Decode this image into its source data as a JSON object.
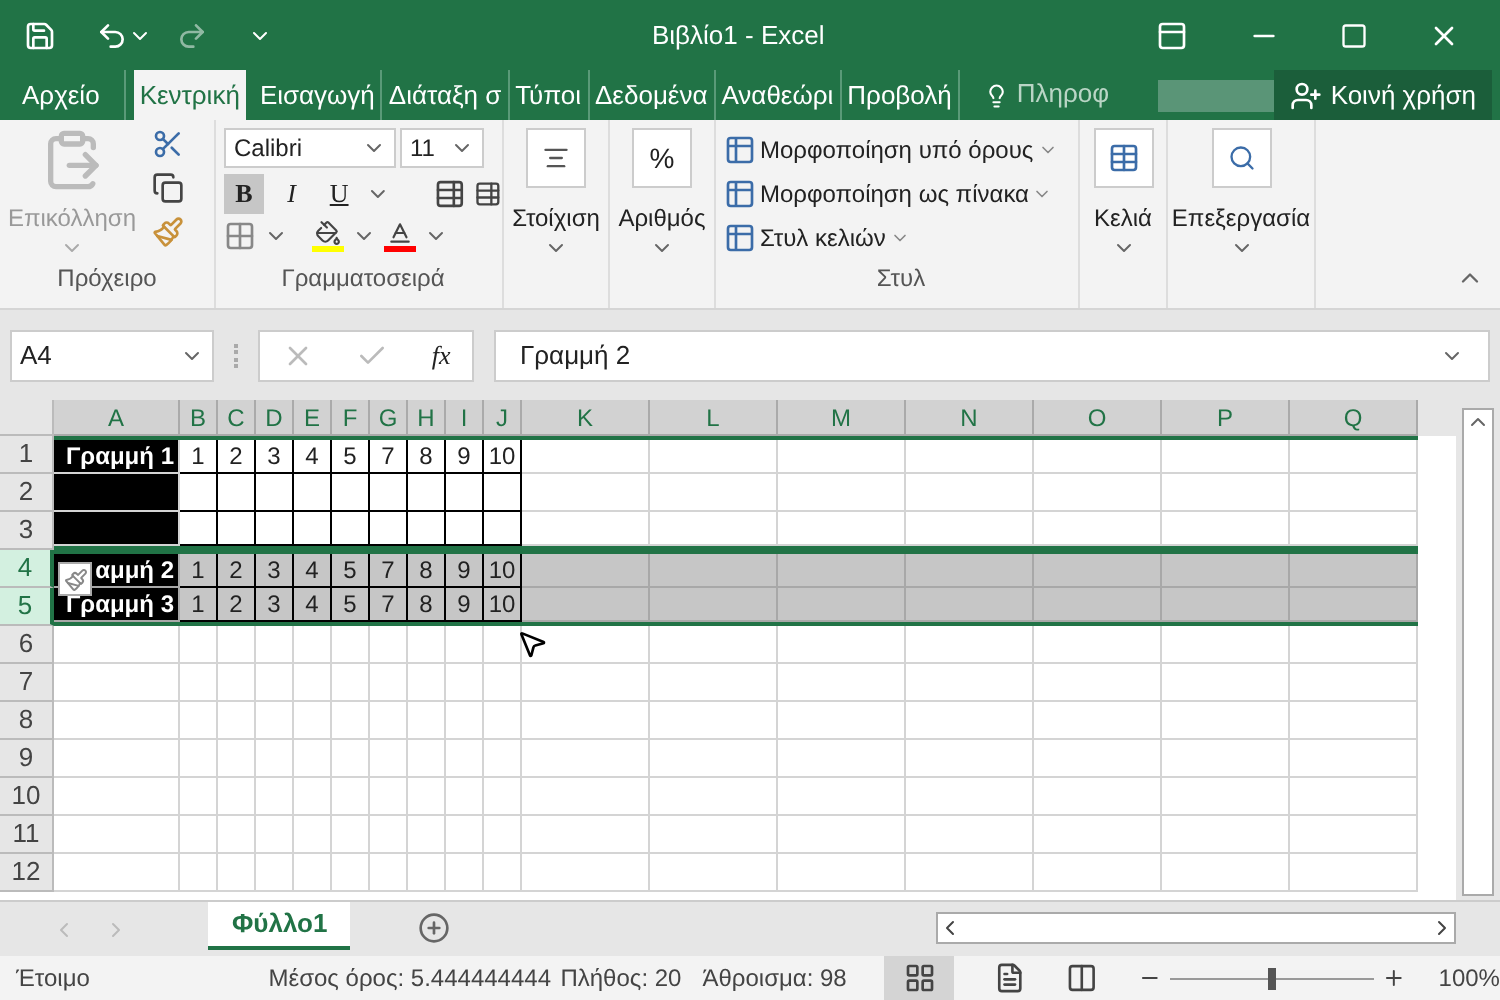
{
  "window": {
    "title": "Βιβλίο1 - Excel"
  },
  "ribbon_tabs": [
    {
      "label": "Αρχείο",
      "selected": false
    },
    {
      "label": "Κεντρική",
      "selected": true
    },
    {
      "label": "Εισαγωγή",
      "selected": false
    },
    {
      "label": "Διάταξη σ",
      "selected": false
    },
    {
      "label": "Τύποι",
      "selected": false
    },
    {
      "label": "Δεδομένα",
      "selected": false
    },
    {
      "label": "Αναθεώρι",
      "selected": false
    },
    {
      "label": "Προβολή",
      "selected": false
    }
  ],
  "tell_me": "Πληροφ",
  "share_button": "Κοινή χρήση",
  "clipboard": {
    "paste": "Επικόλληση",
    "label": "Πρόχειρο"
  },
  "font": {
    "name": "Calibri",
    "size": "11",
    "label": "Γραμματοσειρά",
    "style_buttons": [
      {
        "label": "B",
        "selected": true
      },
      {
        "label": "I",
        "selected": false
      },
      {
        "label": "U",
        "selected": false
      }
    ]
  },
  "alignment": {
    "label": "Στοίχιση"
  },
  "number": {
    "symbol": "%",
    "label": "Αριθμός"
  },
  "styles": {
    "items": [
      "Μορφοποίηση υπό όρους",
      "Μορφοποίηση ως πίνακα",
      "Στυλ κελιών"
    ],
    "label": "Στυλ"
  },
  "cells": {
    "label": "Κελιά"
  },
  "editing": {
    "label": "Επεξεργασία"
  },
  "formula_bar": {
    "name_box": "A4",
    "function_label": "fx",
    "value": "Γραμμή 2"
  },
  "sheet": {
    "columns": [
      "A",
      "B",
      "C",
      "D",
      "E",
      "F",
      "G",
      "H",
      "I",
      "J",
      "K",
      "L",
      "M",
      "N",
      "O",
      "P",
      "Q"
    ],
    "rows": [
      {
        "header": "1",
        "kind": "table",
        "selected": false,
        "marked": true,
        "cells": [
          "Γραμμή 1",
          "1",
          "2",
          "3",
          "4",
          "5",
          "7",
          "8",
          "9",
          "10"
        ]
      },
      {
        "header": "2",
        "kind": "table",
        "selected": false,
        "marked": true,
        "cells": []
      },
      {
        "header": "3",
        "kind": "table",
        "selected": false,
        "marked": true,
        "cells": []
      },
      {
        "header": "4",
        "kind": "table",
        "selected": true,
        "marked": false,
        "cells": [
          "αμμή 2",
          "1",
          "2",
          "3",
          "4",
          "5",
          "7",
          "8",
          "9",
          "10"
        ]
      },
      {
        "header": "5",
        "kind": "table",
        "selected": true,
        "marked": false,
        "cells": [
          "Γραμμή 3",
          "1",
          "2",
          "3",
          "4",
          "5",
          "7",
          "8",
          "9",
          "10"
        ]
      },
      {
        "header": "6",
        "kind": "blank",
        "selected": false,
        "marked": false,
        "cells": []
      },
      {
        "header": "7",
        "kind": "blank",
        "selected": false,
        "marked": false,
        "cells": []
      },
      {
        "header": "8",
        "kind": "blank",
        "selected": false,
        "marked": false,
        "cells": []
      },
      {
        "header": "9",
        "kind": "blank",
        "selected": false,
        "marked": false,
        "cells": []
      },
      {
        "header": "10",
        "kind": "blank",
        "selected": false,
        "marked": false,
        "cells": []
      },
      {
        "header": "11",
        "kind": "blank",
        "selected": false,
        "marked": false,
        "cells": []
      },
      {
        "header": "12",
        "kind": "blank",
        "selected": false,
        "marked": false,
        "cells": []
      }
    ]
  },
  "sheet_tabs": [
    {
      "label": "Φύλλο1",
      "selected": true
    }
  ],
  "status_bar": {
    "mode": "Έτοιμο",
    "average": "Μέσος όρος: 5.444444444",
    "count": "Πλήθος: 20",
    "sum": "Άθροισμα: 98",
    "zoom_slider": {
      "level": 0.5
    },
    "zoom": "100%"
  }
}
